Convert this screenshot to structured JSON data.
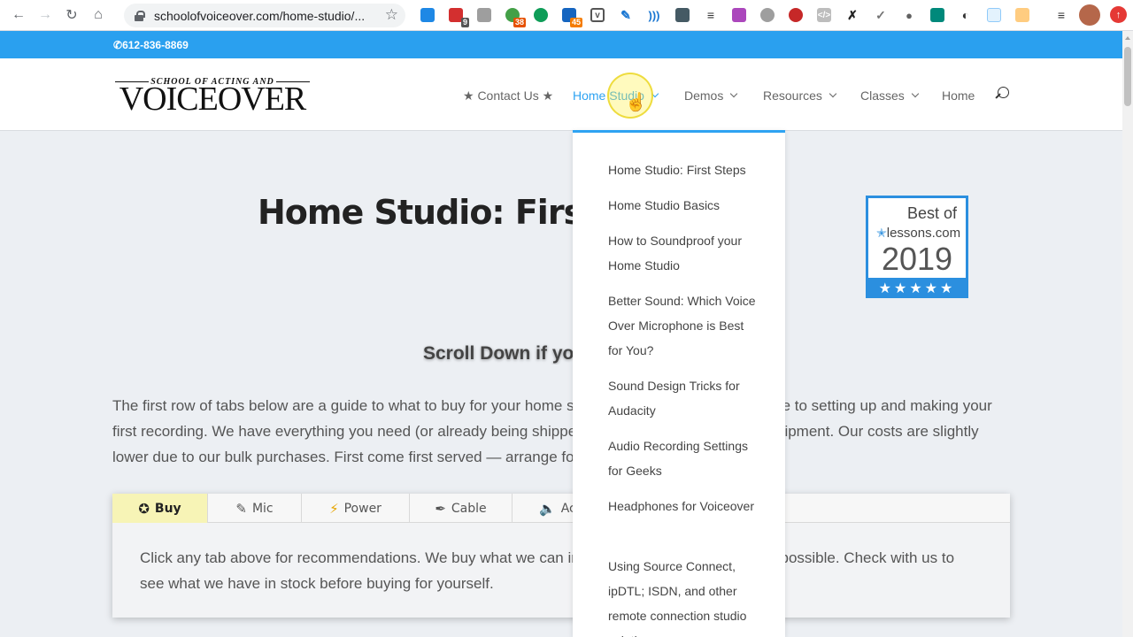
{
  "browser": {
    "url": "schoolofvoiceover.com/home-studio/...",
    "extension_badges": [
      "9",
      "38",
      "45"
    ]
  },
  "topbar": {
    "phone": "612-836-8869"
  },
  "logo": {
    "small_text": "SCHOOL OF ACTING AND",
    "big_text": "VOICEOVER"
  },
  "nav": {
    "contact": "★ Contact Us ★",
    "home_studio": "Home Studio",
    "demos": "Demos",
    "resources": "Resources",
    "classes": "Classes",
    "home": "Home"
  },
  "page": {
    "title": "Home Studio: First Steps",
    "award": {
      "best_of": "Best of",
      "site": "lessons.com",
      "year": "2019",
      "stars": "★★★★★"
    },
    "scroll_prompt": "Scroll Down if you",
    "intro": "The first row of tabs below are a guide to what to buy for your home studio. The second row is a guide to setting up and making your first recording. We have everything you need (or already being shipped) — come to us to pick up equipment. Our costs are slightly lower due to our bulk purchases. First come first served — arrange for pickup."
  },
  "tabs": {
    "items": [
      {
        "label": "Buy",
        "icon": "star-icon"
      },
      {
        "label": "Mic",
        "icon": "microphone-icon"
      },
      {
        "label": "Power",
        "icon": "lightning-icon"
      },
      {
        "label": "Cable",
        "icon": "cable-icon"
      },
      {
        "label": "Ac",
        "icon": "speaker-icon"
      }
    ],
    "content": "Click any tab above for recommendations. We buy what we can in bulk to keep prices as low as possible. Check with us to see what we have in stock before buying for yourself."
  },
  "dropdown": {
    "items": [
      "Home Studio: First Steps",
      "Home Studio Basics",
      "How to Soundproof your Home Studio",
      "Better Sound: Which Voice Over Microphone is Best for You?",
      "Sound Design Tricks for Audacity",
      "Audio Recording Settings for Geeks",
      "Headphones for Voiceover",
      "Using Source Connect, ipDTL; ISDN, and other remote connection studio solutions"
    ]
  },
  "colors": {
    "accent": "#2ea3f2",
    "topbar": "#2aa0ef",
    "active_tab": "#f7f4b6"
  }
}
